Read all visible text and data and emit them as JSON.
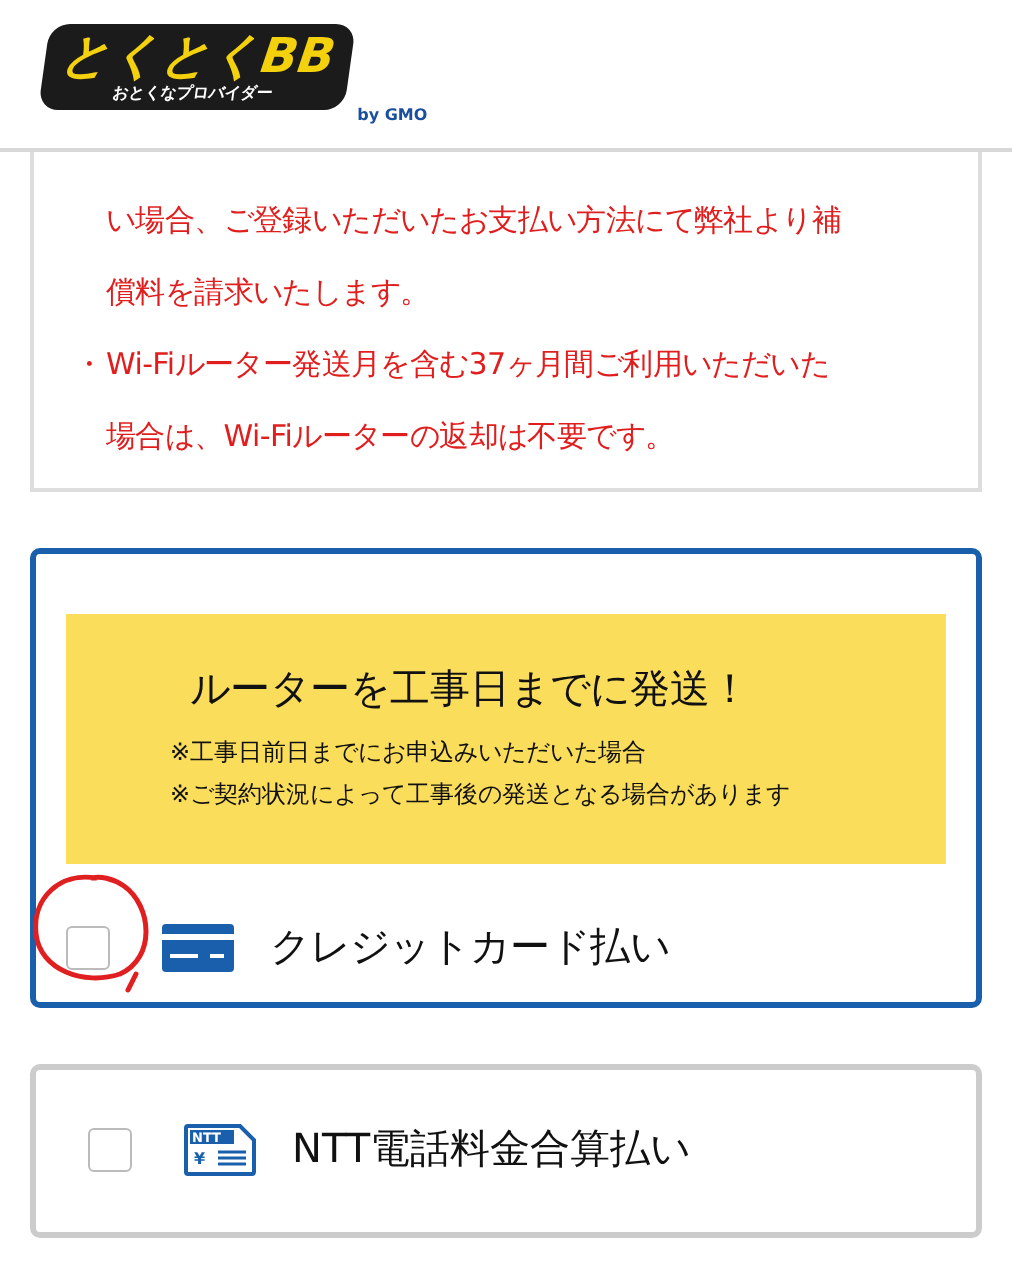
{
  "header": {
    "logo_main": "とくとくBB",
    "logo_sub": "おとくなプロバイダー",
    "logo_by": "by",
    "logo_brand": "GMO"
  },
  "notice": {
    "lines": [
      {
        "text": "い場合、ご登録いただいたお支払い方法にて弊社より補"
      },
      {
        "text": "償料を請求いたします。"
      },
      {
        "mark": "・",
        "text": "Wi-Fiルーター発送月を含む37ヶ月間ご利用いただいた"
      },
      {
        "text": "場合は、Wi-Fiルーターの返却は不要です。"
      }
    ]
  },
  "options": [
    {
      "kind": "card",
      "highlighted": true,
      "checked": false,
      "circled": true,
      "label": "クレジットカード払い",
      "promo": {
        "title": "ルーターを工事日までに発送！",
        "notes": [
          "※工事日前日までにお申込みいただいた場合",
          "※ご契約状況によって工事後の発送となる場合があります"
        ]
      }
    },
    {
      "kind": "ntt",
      "highlighted": false,
      "checked": false,
      "circled": false,
      "label": "NTT電話料金合算払い",
      "icon_text": "NTT",
      "icon_symbol": "¥"
    }
  ]
}
